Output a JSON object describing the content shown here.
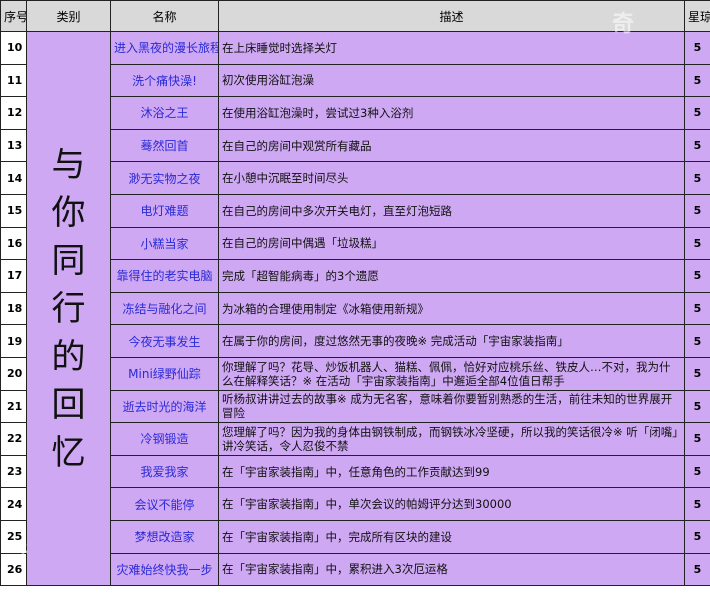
{
  "headers": {
    "num": "序号",
    "cat": "类别",
    "name": "名称",
    "desc": "描述",
    "star": "星琼"
  },
  "category": "与你同行的回忆",
  "rows": [
    {
      "num": "10",
      "name": "进入黑夜的漫长旅程",
      "desc": "在上床睡觉时选择关灯",
      "star": "5"
    },
    {
      "num": "11",
      "name": "洗个痛快澡!",
      "desc": "初次使用浴缸泡澡",
      "star": "5"
    },
    {
      "num": "12",
      "name": "沐浴之王",
      "desc": "在使用浴缸泡澡时，尝试过3种入浴剂",
      "star": "5"
    },
    {
      "num": "13",
      "name": "蓦然回首",
      "desc": "在自己的房间中观赏所有藏品",
      "star": "5"
    },
    {
      "num": "14",
      "name": "渺无实物之夜",
      "desc": "在小憩中沉眠至时间尽头",
      "star": "5"
    },
    {
      "num": "15",
      "name": "电灯难题",
      "desc": "在自己的房间中多次开关电灯，直至灯泡短路",
      "star": "5"
    },
    {
      "num": "16",
      "name": "小糕当家",
      "desc": "在自己的房间中偶遇「垃圾糕」",
      "star": "5"
    },
    {
      "num": "17",
      "name": "靠得住的老实电脑",
      "desc": "完成「超智能病毒」的3个遗愿",
      "star": "5"
    },
    {
      "num": "18",
      "name": "冻结与融化之间",
      "desc": "为冰箱的合理使用制定《冰箱使用新规》",
      "star": "5"
    },
    {
      "num": "19",
      "name": "今夜无事发生",
      "desc": "在属于你的房间，度过悠然无事的夜晚※ 完成活动「宇宙家装指南」",
      "star": "5"
    },
    {
      "num": "20",
      "name": "Mini绿野仙踪",
      "desc": "你理解了吗？花导、炒饭机器人、猫糕、佩佩，恰好对应桃乐丝、铁皮人…不对，我为什么在解释笑话？※ 在活动「宇宙家装指南」中邂逅全部4位值日帮手",
      "star": "5"
    },
    {
      "num": "21",
      "name": "逝去时光的海洋",
      "desc": "听杨叔讲讲过去的故事※ 成为无名客，意味着你要暂别熟悉的生活，前往未知的世界展开冒险",
      "star": "5"
    },
    {
      "num": "22",
      "name": "冷钢锻造",
      "desc": "您理解了吗？因为我的身体由钢铁制成，而钢铁冰冷坚硬，所以我的笑话很冷※ 听「闭嘴」讲冷笑话，令人忍俊不禁",
      "star": "5"
    },
    {
      "num": "23",
      "name": "我爱我家",
      "desc": "在「宇宙家装指南」中，任意角色的工作贡献达到99",
      "star": "5"
    },
    {
      "num": "24",
      "name": "会议不能停",
      "desc": "在「宇宙家装指南」中，单次会议的帕姆评分达到30000",
      "star": "5"
    },
    {
      "num": "25",
      "name": "梦想改造家",
      "desc": "在「宇宙家装指南」中，完成所有区块的建设",
      "star": "5"
    },
    {
      "num": "26",
      "name": "灾难始终快我一步",
      "desc": "在「宇宙家装指南」中，累积进入3次厄运格",
      "star": "5"
    }
  ]
}
